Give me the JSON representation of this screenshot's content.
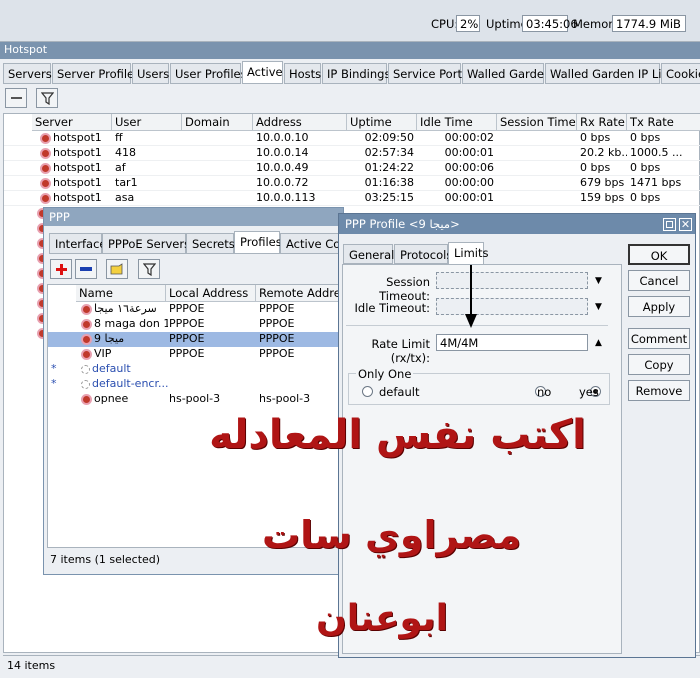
{
  "topbar": {
    "cpu_label": "CPU:",
    "cpu_value": "2%",
    "uptime_label": "Uptime:",
    "uptime_value": "03:45:06",
    "memory_label": "Memory:",
    "memory_value": "1774.9 MiB"
  },
  "hotspot": {
    "title": "Hotspot",
    "tabs": [
      "Servers",
      "Server Profiles",
      "Users",
      "User Profiles",
      "Active",
      "Hosts",
      "IP Bindings",
      "Service Ports",
      "Walled Garden",
      "Walled Garden IP List",
      "Cookies"
    ],
    "active_tab": "Active",
    "columns": [
      "Server",
      "User",
      "Domain",
      "Address",
      "Uptime",
      "Idle Time",
      "Session Time ...",
      "Rx Rate",
      "Tx Rate"
    ],
    "rows": [
      {
        "server": "hotspot1",
        "user": "ff",
        "domain": "",
        "address": "10.0.0.10",
        "uptime": "02:09:50",
        "idle": "00:00:02",
        "session": "",
        "rx": "0 bps",
        "tx": "0 bps"
      },
      {
        "server": "hotspot1",
        "user": "418",
        "domain": "",
        "address": "10.0.0.14",
        "uptime": "02:57:34",
        "idle": "00:00:01",
        "session": "",
        "rx": "20.2 kb...",
        "tx": "1000.5 ..."
      },
      {
        "server": "hotspot1",
        "user": "af",
        "domain": "",
        "address": "10.0.0.49",
        "uptime": "01:24:22",
        "idle": "00:00:06",
        "session": "",
        "rx": "0 bps",
        "tx": "0 bps"
      },
      {
        "server": "hotspot1",
        "user": "tar1",
        "domain": "",
        "address": "10.0.0.72",
        "uptime": "01:16:38",
        "idle": "00:00:00",
        "session": "",
        "rx": "679 bps",
        "tx": "1471 bps"
      },
      {
        "server": "hotspot1",
        "user": "asa",
        "domain": "",
        "address": "10.0.0.113",
        "uptime": "03:25:15",
        "idle": "00:00:01",
        "session": "",
        "rx": "159 bps",
        "tx": "0 bps"
      }
    ],
    "status": "14 items"
  },
  "ppp": {
    "title": "PPP",
    "tabs": [
      "Interface",
      "PPPoE Servers",
      "Secrets",
      "Profiles",
      "Active Con"
    ],
    "active_tab": "Profiles",
    "columns": [
      "Name",
      "Local Address",
      "Remote Address"
    ],
    "rows": [
      {
        "flag": "",
        "name": "سرعة١٦ ميجا",
        "local": "PPPOE",
        "remote": "PPPOE"
      },
      {
        "flag": "",
        "name": "8 maga don 1",
        "local": "PPPOE",
        "remote": "PPPOE"
      },
      {
        "flag": "",
        "name": "ميجا 9",
        "local": "PPPOE",
        "remote": "PPPOE"
      },
      {
        "flag": "",
        "name": "VIP",
        "local": "PPPOE",
        "remote": "PPPOE"
      },
      {
        "flag": "*",
        "name": "default",
        "local": "",
        "remote": ""
      },
      {
        "flag": "*",
        "name": "default-encr...",
        "local": "",
        "remote": ""
      },
      {
        "flag": "",
        "name": "opnee",
        "local": "hs-pool-3",
        "remote": "hs-pool-3"
      }
    ],
    "status": "7 items (1 selected)"
  },
  "profile": {
    "title": "PPP Profile <ميجا 9>",
    "tabs": [
      "General",
      "Protocols",
      "Limits"
    ],
    "active_tab": "Limits",
    "session_timeout_label": "Session Timeout:",
    "idle_timeout_label": "Idle Timeout:",
    "rate_limit_label": "Rate Limit (rx/tx):",
    "rate_limit_value": "4M/4M",
    "only_one_label": "Only One",
    "radio_default": "default",
    "radio_no": "no",
    "radio_yes": "yes",
    "buttons": [
      "OK",
      "Cancel",
      "Apply",
      "Comment",
      "Copy",
      "Remove"
    ]
  },
  "overlay": {
    "line1": "اكتب نفس المعادله",
    "line2": "مصراوي سات",
    "line3": "ابوعنان"
  },
  "colors": {
    "titlebar": "#6d8aaa",
    "overlay_text": "#b01515",
    "selected_row": "#9db9e3"
  }
}
